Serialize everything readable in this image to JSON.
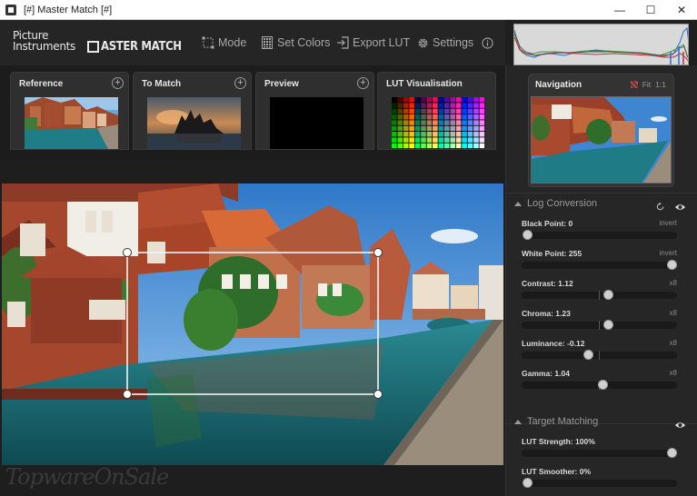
{
  "window": {
    "title": "[#] Master Match [#]",
    "minimize": "—",
    "maximize": "☐",
    "close": "✕"
  },
  "logo": {
    "line1": "Picture",
    "line2": "Instruments",
    "product": "ASTER MATCH"
  },
  "toolbar": {
    "mode": "Mode",
    "set_colors": "Set Colors",
    "export_lut": "Export LUT",
    "settings": "Settings",
    "info_icon": "info-icon"
  },
  "thumbnails": [
    {
      "label": "Reference"
    },
    {
      "label": "To Match"
    },
    {
      "label": "Preview"
    },
    {
      "label": "LUT Visualisation"
    }
  ],
  "navigation": {
    "title": "Navigation",
    "fit": "Fit",
    "one_to_one": "1:1"
  },
  "log_conversion": {
    "title": "Log Conversion",
    "params": [
      {
        "label": "Black Point: 0",
        "aux": "invert",
        "position": 0.0,
        "centered": false
      },
      {
        "label": "White Point: 255",
        "aux": "invert",
        "position": 1.0,
        "centered": false
      },
      {
        "label": "Contrast: 1.12",
        "aux": "x8",
        "position": 0.56,
        "centered": true
      },
      {
        "label": "Chroma: 1.23",
        "aux": "x8",
        "position": 0.56,
        "centered": true
      },
      {
        "label": "Luminance: -0.12",
        "aux": "x8",
        "position": 0.42,
        "centered": true
      },
      {
        "label": "Gamma: 1.04",
        "aux": "x8",
        "position": 0.52,
        "centered": true
      }
    ]
  },
  "target_matching": {
    "title": "Target Matching",
    "params": [
      {
        "label": "LUT Strength: 100%",
        "aux": "",
        "position": 1.0,
        "centered": false
      },
      {
        "label": "LUT Smoother: 0%",
        "aux": "",
        "position": 0.0,
        "centered": false
      }
    ]
  },
  "watermark": "TopwareOnSale",
  "colors": {
    "accent": "#cfcfcf",
    "panel": "#262626",
    "toolbar_text": "#a8a8a8"
  }
}
